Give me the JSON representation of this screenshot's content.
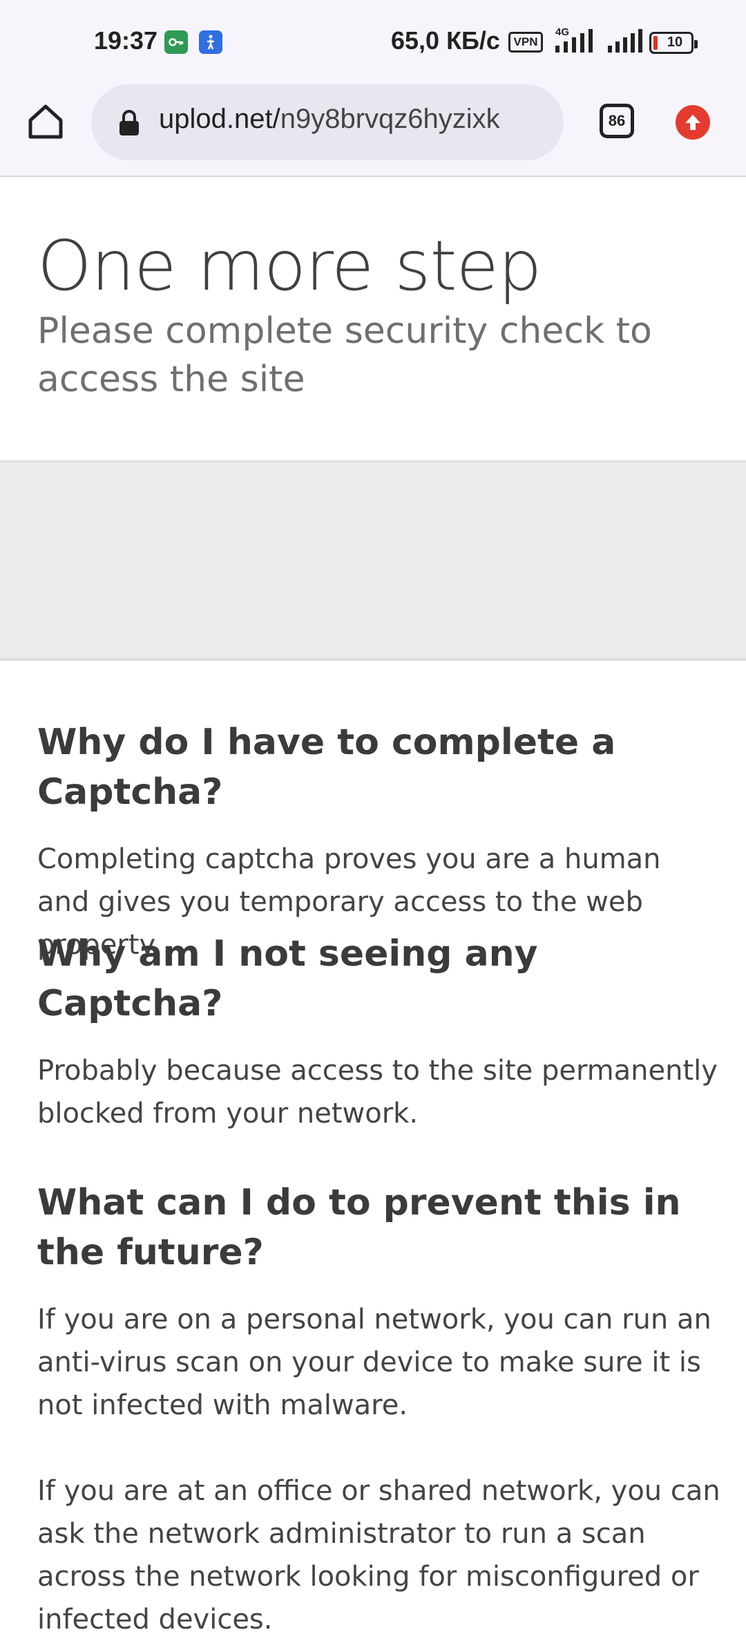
{
  "status_bar": {
    "time": "19:37",
    "network_speed": "65,0 КБ/с",
    "vpn_label": "VPN",
    "network_type": "4G",
    "battery_level": "10",
    "icons": [
      "vpn-key-icon",
      "accessibility-icon",
      "signal-icon",
      "battery-icon"
    ]
  },
  "browser": {
    "url_domain": "uplod.net/",
    "url_path": "n9y8brvqz6hyzixk",
    "tab_count": "86",
    "icons": [
      "home-icon",
      "lock-icon",
      "tabs-icon",
      "update-icon"
    ],
    "colors": {
      "update_accent": "#e53a2f"
    }
  },
  "page": {
    "title": "One more step",
    "subtitle": "Please complete security check to access the site",
    "faq": [
      {
        "question": "Why do I have to complete a Captcha?",
        "answer": "Completing captcha proves you are a human and gives you temporary access to the web property."
      },
      {
        "question": "Why am I not seeing any Captcha?",
        "answer": "Probably because access to the site permanently blocked from your network."
      },
      {
        "question": "What can I do to prevent this in the future?",
        "answer": "If you are on a personal network, you can run an anti-virus scan on your device to make sure it is not infected with malware.",
        "answer2": "If you are at an office or shared network, you can ask the network administrator to run a scan across the network looking for misconfigured or infected devices."
      }
    ]
  }
}
